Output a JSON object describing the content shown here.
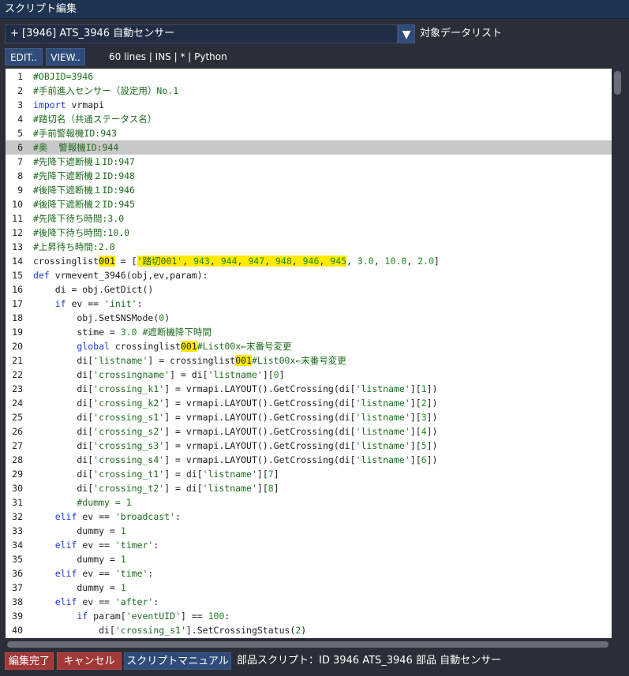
{
  "window": {
    "title": "スクリプト編集"
  },
  "target": {
    "selected": "+ [3946] ATS_3946 自動センサー",
    "dropdown_icon": "▼",
    "label": "対象データリスト"
  },
  "toolbar": {
    "edit_label": "EDIT..",
    "view_label": "VIEW..",
    "status": "60 lines  | INS | * | Python"
  },
  "editor": {
    "current_line": 6,
    "lines": [
      {
        "n": "1",
        "html": "<span class=\"cmt\">#OBJID=3946</span>"
      },
      {
        "n": "2",
        "html": "<span class=\"cmt\">#手前進入センサー（設定用）No.1</span>"
      },
      {
        "n": "3",
        "html": "<span class=\"kw\">import</span> vrmapi"
      },
      {
        "n": "4",
        "html": "<span class=\"cmt\">#踏切名（共通ステータス名）</span>"
      },
      {
        "n": "5",
        "html": "<span class=\"cmt\">#手前警報機ID:943</span>"
      },
      {
        "n": "6",
        "html": "<span class=\"cmt\">#奥  警報機ID:944</span>"
      },
      {
        "n": "7",
        "html": "<span class=\"cmt\">#先降下遮断機１ID:947</span>"
      },
      {
        "n": "8",
        "html": "<span class=\"cmt\">#先降下遮断機２ID:948</span>"
      },
      {
        "n": "9",
        "html": "<span class=\"cmt\">#後降下遮断機１ID:946</span>"
      },
      {
        "n": "10",
        "html": "<span class=\"cmt\">#後降下遮断機２ID:945</span>"
      },
      {
        "n": "11",
        "html": "<span class=\"cmt\">#先降下待ち時間:3.0</span>"
      },
      {
        "n": "12",
        "html": "<span class=\"cmt\">#後降下待ち時間:10.0</span>"
      },
      {
        "n": "13",
        "html": "<span class=\"cmt\">#上昇待ち時間:2.0</span>"
      },
      {
        "n": "14",
        "html": "crossinglist<span class=\"hl\">001</span> = [<span class=\"hl\"><span class=\"str\">'踏切001'</span>, <span class=\"num\">943</span>, <span class=\"num\">944</span>, <span class=\"num\">947</span>, <span class=\"num\">948</span>, <span class=\"num\">946</span>, <span class=\"num\">945</span></span>, <span class=\"num\">3.0</span>, <span class=\"num\">10.0</span>, <span class=\"num\">2.0</span>]"
      },
      {
        "n": "15",
        "html": "<span class=\"kw\">def</span> vrmevent_3946(obj,ev,param):"
      },
      {
        "n": "16",
        "html": "    di = obj.GetDict()"
      },
      {
        "n": "17",
        "html": "    <span class=\"kw\">if</span> ev == <span class=\"str\">'init'</span>:"
      },
      {
        "n": "18",
        "html": "        obj.SetSNSMode(<span class=\"num\">0</span>)"
      },
      {
        "n": "19",
        "html": "        stime = <span class=\"num\">3.0</span> <span class=\"cmt\">#遮断機降下時間</span>"
      },
      {
        "n": "20",
        "html": "        <span class=\"kw\">global</span> crossinglist<span class=\"hl\">001</span><span class=\"cmt\">#List00x←末番号変更</span>"
      },
      {
        "n": "21",
        "html": "        di[<span class=\"str\">'listname'</span>] = crossinglist<span class=\"hl\">001</span><span class=\"cmt\">#List00x←末番号変更</span>"
      },
      {
        "n": "22",
        "html": "        di[<span class=\"str\">'crossingname'</span>] = di[<span class=\"str\">'listname'</span>][<span class=\"num\">0</span>]"
      },
      {
        "n": "23",
        "html": "        di[<span class=\"str\">'crossing_k1'</span>] = vrmapi.LAYOUT().GetCrossing(di[<span class=\"str\">'listname'</span>][<span class=\"num\">1</span>])"
      },
      {
        "n": "24",
        "html": "        di[<span class=\"str\">'crossing_k2'</span>] = vrmapi.LAYOUT().GetCrossing(di[<span class=\"str\">'listname'</span>][<span class=\"num\">2</span>])"
      },
      {
        "n": "25",
        "html": "        di[<span class=\"str\">'crossing_s1'</span>] = vrmapi.LAYOUT().GetCrossing(di[<span class=\"str\">'listname'</span>][<span class=\"num\">3</span>])"
      },
      {
        "n": "26",
        "html": "        di[<span class=\"str\">'crossing_s2'</span>] = vrmapi.LAYOUT().GetCrossing(di[<span class=\"str\">'listname'</span>][<span class=\"num\">4</span>])"
      },
      {
        "n": "27",
        "html": "        di[<span class=\"str\">'crossing_s3'</span>] = vrmapi.LAYOUT().GetCrossing(di[<span class=\"str\">'listname'</span>][<span class=\"num\">5</span>])"
      },
      {
        "n": "28",
        "html": "        di[<span class=\"str\">'crossing_s4'</span>] = vrmapi.LAYOUT().GetCrossing(di[<span class=\"str\">'listname'</span>][<span class=\"num\">6</span>])"
      },
      {
        "n": "29",
        "html": "        di[<span class=\"str\">'crossing_t1'</span>] = di[<span class=\"str\">'listname'</span>][<span class=\"num\">7</span>]"
      },
      {
        "n": "30",
        "html": "        di[<span class=\"str\">'crossing_t2'</span>] = di[<span class=\"str\">'listname'</span>][<span class=\"num\">8</span>]"
      },
      {
        "n": "31",
        "html": "        <span class=\"cmt\">#dummy = 1</span>"
      },
      {
        "n": "32",
        "html": "    <span class=\"kw\">elif</span> ev == <span class=\"str\">'broadcast'</span>:"
      },
      {
        "n": "33",
        "html": "        dummy = <span class=\"num\">1</span>"
      },
      {
        "n": "34",
        "html": "    <span class=\"kw\">elif</span> ev == <span class=\"str\">'timer'</span>:"
      },
      {
        "n": "35",
        "html": "        dummy = <span class=\"num\">1</span>"
      },
      {
        "n": "36",
        "html": "    <span class=\"kw\">elif</span> ev == <span class=\"str\">'time'</span>:"
      },
      {
        "n": "37",
        "html": "        dummy = <span class=\"num\">1</span>"
      },
      {
        "n": "38",
        "html": "    <span class=\"kw\">elif</span> ev == <span class=\"str\">'after'</span>:"
      },
      {
        "n": "39",
        "html": "        <span class=\"kw\">if</span> param[<span class=\"str\">'eventUID'</span>] == <span class=\"num\">100</span>:"
      },
      {
        "n": "40",
        "html": "            di[<span class=\"str\">'crossing_s1'</span>].SetCrossingStatus(<span class=\"num\">2</span>)"
      }
    ]
  },
  "footer": {
    "done_label": "編集完了",
    "cancel_label": "キャンセル",
    "manual_label": "スクリプトマニュアル",
    "part_label": "部品スクリプト：ID 3946 ATS_3946 部品 自動センサー"
  }
}
